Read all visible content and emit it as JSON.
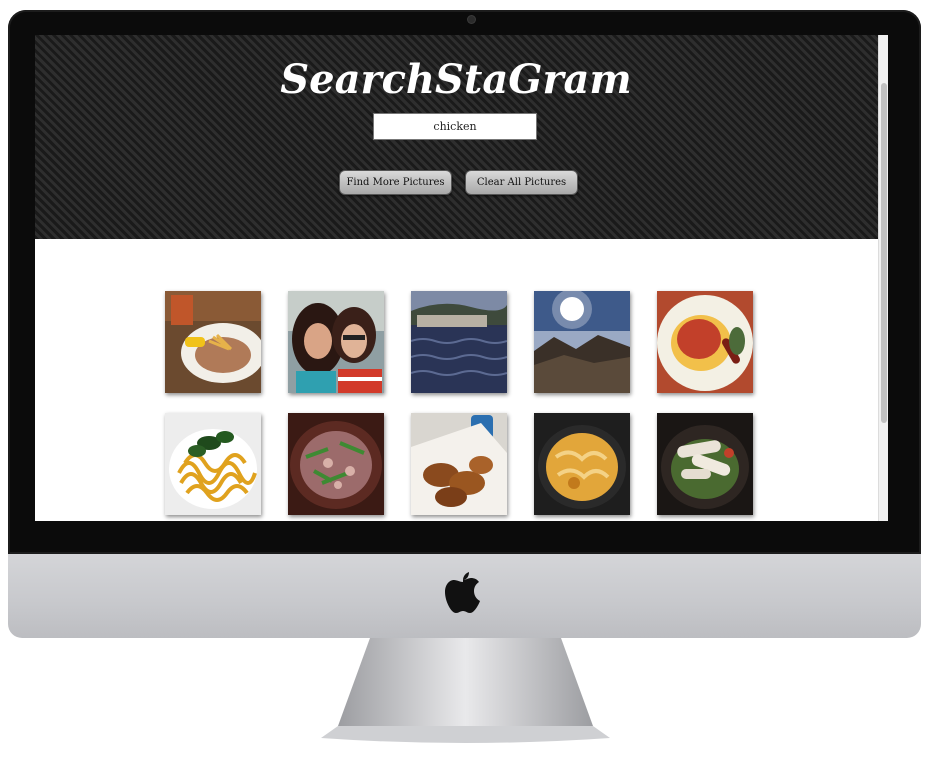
{
  "app": {
    "title": "SearchStaGram"
  },
  "search": {
    "value": "chicken",
    "placeholder": ""
  },
  "buttons": {
    "find_more_label": "Find More Pictures",
    "clear_all_label": "Clear All Pictures"
  },
  "colors": {
    "header_background": "#232323",
    "button_gradient_top": "#d9d9d9",
    "button_gradient_bottom": "#a8a8a8",
    "page_background": "#ffffff"
  },
  "photos": [
    {
      "subject": "plate-of-fries-and-meat"
    },
    {
      "subject": "two-people-selfie"
    },
    {
      "subject": "seaside-town"
    },
    {
      "subject": "mountain-sunset"
    },
    {
      "subject": "stew-on-plate"
    },
    {
      "subject": "pasta-with-basil"
    },
    {
      "subject": "meat-and-green-beans"
    },
    {
      "subject": "chicken-wings-box"
    },
    {
      "subject": "curry-dish"
    },
    {
      "subject": "chicken-salad"
    }
  ]
}
